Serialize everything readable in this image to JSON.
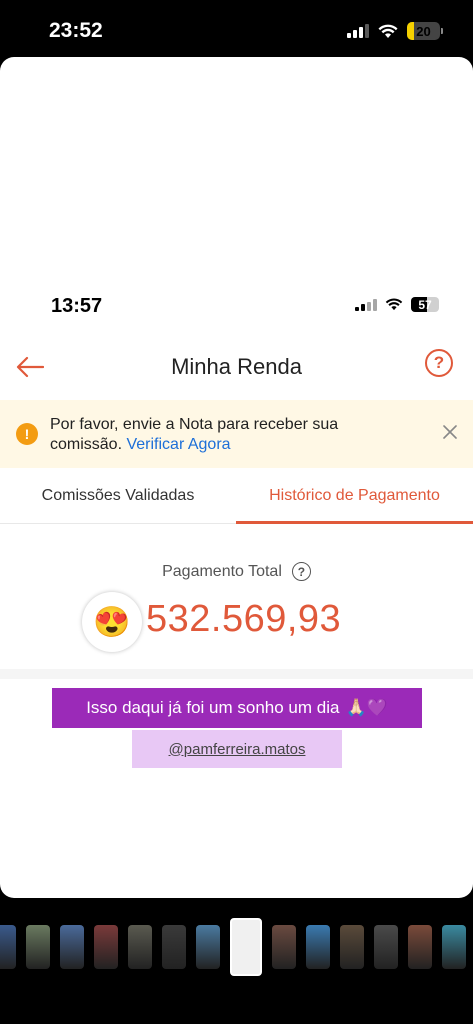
{
  "outer_status": {
    "time": "23:52",
    "battery": "20"
  },
  "inner_status": {
    "time": "13:57",
    "battery": "57"
  },
  "header": {
    "title": "Minha Renda",
    "help_symbol": "?"
  },
  "notice": {
    "icon_symbol": "!",
    "text": "Por favor, envie a Nota para receber sua comissão.",
    "link": "Verificar Agora"
  },
  "tabs": [
    {
      "label": "Comissões Validadas",
      "active": false
    },
    {
      "label": "Histórico de Pagamento",
      "active": true
    }
  ],
  "payment": {
    "label": "Pagamento Total",
    "help_symbol": "?",
    "amount": "532.569,93",
    "sticker_emoji": "😍"
  },
  "story_overlay": {
    "caption": "Isso daqui já foi um sonho um dia",
    "caption_emojis": "🙏🏻💜",
    "mention": "@pamferreira.matos"
  },
  "colors": {
    "accent": "#e0593a",
    "notice_bg": "#fff8e5",
    "caption_bg": "#9b2ab8",
    "mention_bg": "#e8c8f5",
    "link": "#1d6fd8"
  },
  "thumbnails": [
    {
      "color": "#3a5a8c",
      "active": false
    },
    {
      "color": "#6a7a60",
      "active": false
    },
    {
      "color": "#4a6a9a",
      "active": false
    },
    {
      "color": "#7a3a3a",
      "active": false
    },
    {
      "color": "#5a5a50",
      "active": false
    },
    {
      "color": "#3a3a3a",
      "active": false
    },
    {
      "color": "#4a7aa0",
      "active": false
    },
    {
      "color": "#f0f0f0",
      "active": true
    },
    {
      "color": "#6a4a40",
      "active": false
    },
    {
      "color": "#3a7ab0",
      "active": false
    },
    {
      "color": "#5a4a3a",
      "active": false
    },
    {
      "color": "#4a4a4a",
      "active": false
    },
    {
      "color": "#7a4a3a",
      "active": false
    },
    {
      "color": "#3a8aa0",
      "active": false
    }
  ]
}
